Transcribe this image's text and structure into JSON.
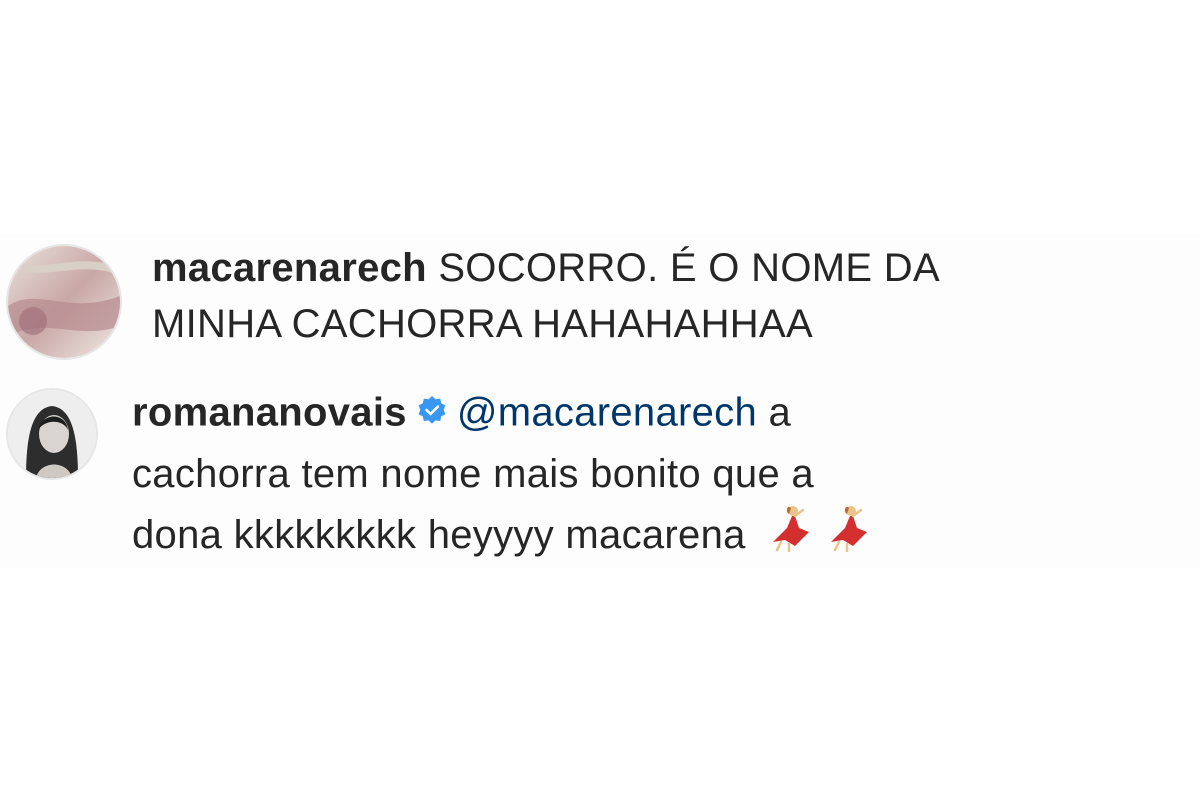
{
  "comments": [
    {
      "username": "macarenarech",
      "line1": "SOCORRO. É O NOME DA",
      "line2": "MINHA CACHORRA HAHAHAHHAA"
    },
    {
      "username": "romananovais",
      "verified": true,
      "mention": "@macarenarech",
      "line1_tail": "a",
      "line2": "cachorra tem nome mais bonito que a",
      "line3": "dona kkkkkkkkk heyyyy macarena",
      "emojis": [
        "dancer-emoji",
        "dancer-emoji"
      ]
    }
  ],
  "colors": {
    "text": "#262626",
    "mention": "#00376b",
    "verified_badge": "#3897f0"
  }
}
